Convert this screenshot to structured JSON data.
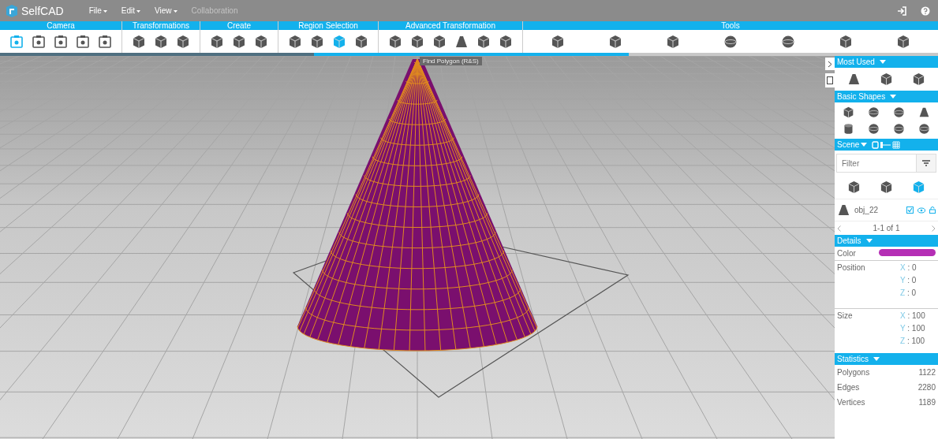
{
  "menubar": {
    "logo": "SelfCAD",
    "menus": [
      {
        "label": "File",
        "disabled": false
      },
      {
        "label": "Edit",
        "disabled": false
      },
      {
        "label": "View",
        "disabled": false
      },
      {
        "label": "Collaboration",
        "disabled": true
      }
    ]
  },
  "toolbar": [
    {
      "title": "Camera",
      "tools": [
        {
          "kind": "frame",
          "active": true
        },
        {
          "kind": "frame",
          "active": false
        },
        {
          "kind": "frame",
          "active": false
        },
        {
          "kind": "frame",
          "active": false
        },
        {
          "kind": "frame",
          "active": false
        }
      ]
    },
    {
      "title": "Transformations",
      "tools": [
        {
          "kind": "cube",
          "active": false
        },
        {
          "kind": "cube",
          "active": false
        },
        {
          "kind": "cube",
          "active": false
        }
      ]
    },
    {
      "title": "Create",
      "tools": [
        {
          "kind": "cube",
          "active": false
        },
        {
          "kind": "cube",
          "active": false
        },
        {
          "kind": "cube",
          "active": false
        }
      ]
    },
    {
      "title": "Region Selection",
      "tools": [
        {
          "kind": "cube",
          "active": false
        },
        {
          "kind": "cube",
          "active": false
        },
        {
          "kind": "cube",
          "active": true
        },
        {
          "kind": "cube",
          "active": false
        }
      ]
    },
    {
      "title": "Advanced Transformation",
      "tools": [
        {
          "kind": "cube",
          "active": false
        },
        {
          "kind": "cube",
          "active": false
        },
        {
          "kind": "cube",
          "active": false
        },
        {
          "kind": "cone",
          "active": false
        },
        {
          "kind": "cube",
          "active": false
        },
        {
          "kind": "cube",
          "active": false
        }
      ]
    },
    {
      "title": "Tools",
      "tools": [
        {
          "kind": "cube",
          "active": false
        },
        {
          "kind": "cube",
          "active": false
        },
        {
          "kind": "cube",
          "active": false
        },
        {
          "kind": "sphere",
          "active": false
        },
        {
          "kind": "sphere",
          "active": false
        },
        {
          "kind": "cube",
          "active": false
        },
        {
          "kind": "cube",
          "active": false
        }
      ]
    }
  ],
  "tooltip": "Find Polygon (R&S)",
  "progress": {
    "level": 0.67
  },
  "panel": {
    "most_used": {
      "title": "Most Used",
      "items": [
        {
          "kind": "cone"
        },
        {
          "kind": "cube"
        },
        {
          "kind": "cube"
        }
      ]
    },
    "basic_shapes": {
      "title": "Basic Shapes",
      "items": [
        {
          "kind": "cube"
        },
        {
          "kind": "sphere"
        },
        {
          "kind": "sphere"
        },
        {
          "kind": "cone"
        },
        {
          "kind": "cylinder"
        },
        {
          "kind": "sphere"
        },
        {
          "kind": "sphere"
        },
        {
          "kind": "sphere"
        }
      ]
    },
    "scene": {
      "title": "Scene",
      "filter": {
        "placeholder": "Filter"
      },
      "views": [
        {
          "selected": false
        },
        {
          "selected": false
        },
        {
          "selected": true
        }
      ],
      "objects": [
        {
          "name": "obj_22",
          "visible_checked": true
        }
      ],
      "pagination": "1-1 of 1"
    },
    "details": {
      "title": "Details",
      "color_label": "Color",
      "color": "#b52fb5",
      "position": {
        "label": "Position",
        "values": [
          {
            "axis": "X",
            "value": ": 0"
          },
          {
            "axis": "Y",
            "value": ": 0"
          },
          {
            "axis": "Z",
            "value": ": 0"
          }
        ]
      },
      "size": {
        "label": "Size",
        "values": [
          {
            "axis": "X",
            "value": ": 100"
          },
          {
            "axis": "Y",
            "value": ": 100"
          },
          {
            "axis": "Z",
            "value": ": 100"
          }
        ]
      }
    },
    "statistics": {
      "title": "Statistics",
      "rows": [
        {
          "label": "Polygons",
          "value": "1122"
        },
        {
          "label": "Edges",
          "value": "2280"
        },
        {
          "label": "Vertices",
          "value": "1189"
        }
      ]
    }
  }
}
